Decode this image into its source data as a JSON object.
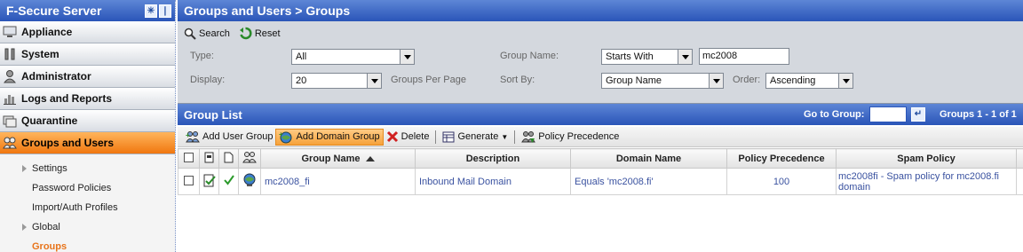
{
  "sidebar": {
    "title": "F-Secure Server",
    "header_icons": [
      "collapse-icon",
      "pin-icon"
    ],
    "items": [
      {
        "label": "Appliance",
        "icon": "appliance-icon"
      },
      {
        "label": "System",
        "icon": "system-icon"
      },
      {
        "label": "Administrator",
        "icon": "administrator-icon"
      },
      {
        "label": "Logs and Reports",
        "icon": "chart-icon"
      },
      {
        "label": "Quarantine",
        "icon": "quarantine-icon"
      },
      {
        "label": "Groups and Users",
        "icon": "groups-icon",
        "active": true
      }
    ],
    "subitems": [
      {
        "label": "Settings",
        "expandable": true
      },
      {
        "label": "Password Policies"
      },
      {
        "label": "Import/Auth Profiles"
      },
      {
        "label": "Global",
        "expandable": true
      },
      {
        "label": "Groups",
        "current": true
      }
    ]
  },
  "header": {
    "title": "Groups and Users > Groups"
  },
  "search_toolbar": {
    "search_label": "Search",
    "reset_label": "Reset"
  },
  "filters": {
    "type_label": "Type:",
    "type_value": "All",
    "display_label": "Display:",
    "display_value": "20",
    "per_page_label": "Groups Per Page",
    "group_name_label": "Group Name:",
    "group_name_match": "Starts With",
    "group_name_value": "mc2008",
    "sort_by_label": "Sort By:",
    "sort_by_value": "Group Name",
    "order_label": "Order:",
    "order_value": "Ascending"
  },
  "list": {
    "title": "Group List",
    "goto_label": "Go to Group:",
    "count_label": "Groups 1 - 1 of 1"
  },
  "actions": {
    "add_user_group": "Add User Group",
    "add_domain_group": "Add Domain Group",
    "delete": "Delete",
    "generate": "Generate",
    "policy_precedence": "Policy Precedence"
  },
  "table": {
    "columns": [
      "Group Name",
      "Description",
      "Domain Name",
      "Policy Precedence",
      "Spam Policy"
    ],
    "rows": [
      {
        "group_name": "mc2008_fi",
        "description": "Inbound Mail Domain",
        "domain_name": "Equals 'mc2008.fi'",
        "policy_precedence": "100",
        "spam_policy": "mc2008fi - Spam policy for mc2008.fi domain"
      }
    ]
  },
  "colors": {
    "accent": "#2a55b8",
    "active_nav": "#f0770f",
    "link": "#3a52a0"
  }
}
